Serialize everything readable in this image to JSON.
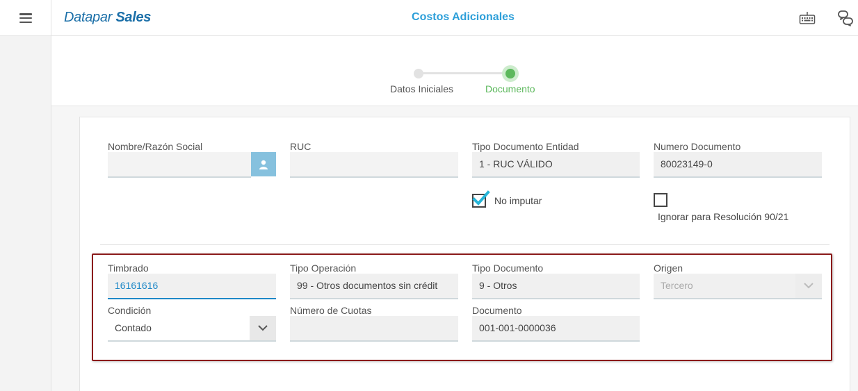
{
  "header": {
    "logo_part1": "Datapar",
    "logo_part2": "Sales",
    "title": "Costos Adicionales",
    "icons": [
      "menu-icon",
      "keyboard-icon",
      "chat-icon"
    ]
  },
  "stepper": {
    "steps": [
      {
        "label": "Datos Iniciales",
        "state": "done"
      },
      {
        "label": "Documento",
        "state": "active"
      }
    ],
    "colors": {
      "active": "#5cb85c",
      "inactive": "#e2e2e2"
    }
  },
  "entity": {
    "nombre": {
      "label": "Nombre/Razón Social",
      "value": ""
    },
    "ruc": {
      "label": "RUC",
      "value": ""
    },
    "tipo_doc_entidad": {
      "label": "Tipo Documento Entidad",
      "value": "1 - RUC VÁLIDO"
    },
    "numero_documento": {
      "label": "Numero Documento",
      "value": "80023149-0"
    },
    "no_imputar": {
      "label": "No imputar",
      "checked": true
    },
    "ignorar_resolucion": {
      "label": "Ignorar para Resolución 90/21",
      "checked": false
    }
  },
  "document": {
    "timbrado": {
      "label": "Timbrado",
      "value": "16161616"
    },
    "tipo_operacion": {
      "label": "Tipo Operación",
      "value": "99 - Otros documentos sin crédit"
    },
    "tipo_documento": {
      "label": "Tipo Documento",
      "value": "9 - Otros"
    },
    "origen": {
      "label": "Origen",
      "value": "Tercero"
    },
    "condicion": {
      "label": "Condición",
      "value": "Contado"
    },
    "numero_cuotas": {
      "label": "Número de Cuotas",
      "value": ""
    },
    "documento": {
      "label": "Documento",
      "value": "001-001-0000036"
    }
  },
  "colors": {
    "accent": "#2d9fd9",
    "brand": "#1b6fa8",
    "highlight_border": "#8b1a1a"
  }
}
